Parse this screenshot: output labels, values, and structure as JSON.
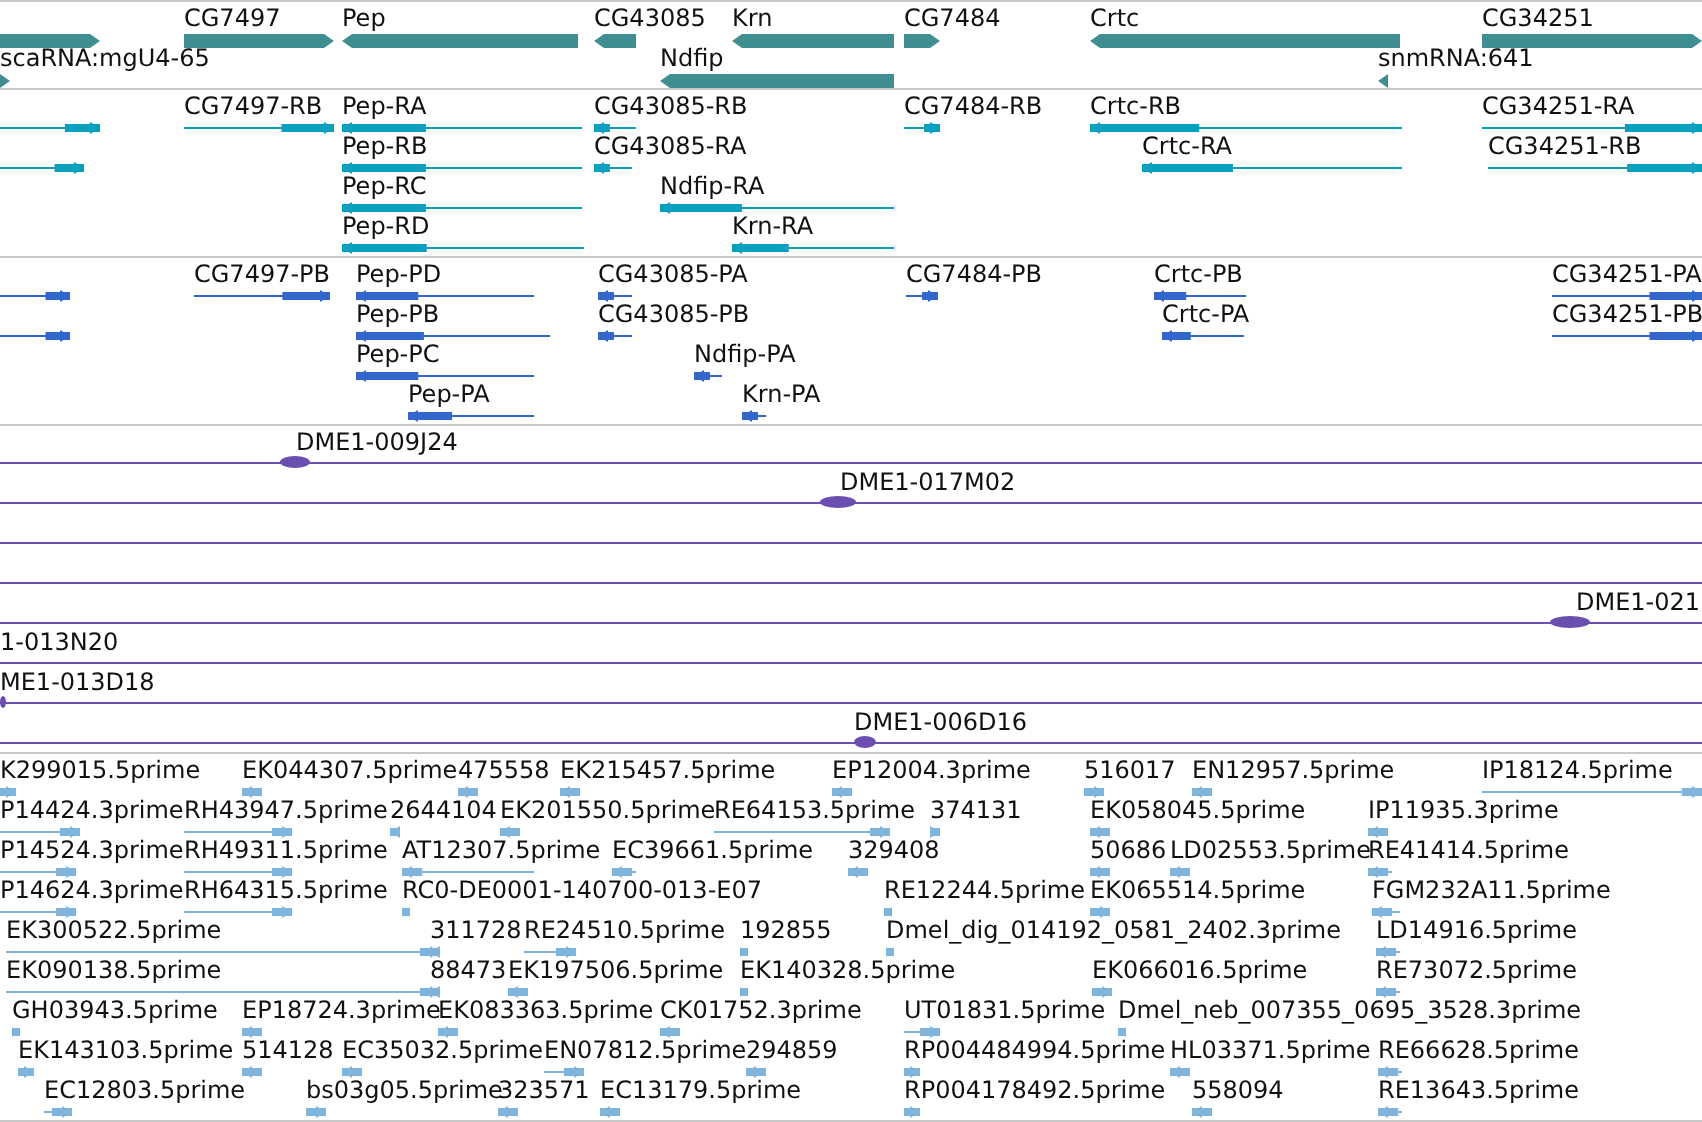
{
  "tracks": [
    {
      "kind": "gene",
      "color": "#3e8e92",
      "features": [
        {
          "label": "CG7497"
        },
        {
          "label": "Pep"
        },
        {
          "label": "CG43085"
        },
        {
          "label": "Krn"
        },
        {
          "label": "CG7484"
        },
        {
          "label": "Crtc"
        },
        {
          "label": "CG34251"
        },
        {
          "label": "scaRNA:mgU4-65"
        },
        {
          "label": "Ndfip"
        },
        {
          "label": "snmRNA:641"
        }
      ]
    },
    {
      "kind": "transcript",
      "color": "#09a0c0",
      "features": [
        {
          "label": "CG7497-RB"
        },
        {
          "label": "Pep-RA"
        },
        {
          "label": "CG43085-RB"
        },
        {
          "label": "CG7484-RB"
        },
        {
          "label": "Crtc-RB"
        },
        {
          "label": "CG34251-RA"
        },
        {
          "label": "Pep-RB"
        },
        {
          "label": "CG43085-RA"
        },
        {
          "label": "Crtc-RA"
        },
        {
          "label": "CG34251-RB"
        },
        {
          "label": "Pep-RC"
        },
        {
          "label": "Ndfip-RA"
        },
        {
          "label": "Pep-RD"
        },
        {
          "label": "Krn-RA"
        }
      ]
    },
    {
      "kind": "transcript",
      "color": "#3366cc",
      "features": [
        {
          "label": "CG7497-PB"
        },
        {
          "label": "Pep-PD"
        },
        {
          "label": "CG43085-PA"
        },
        {
          "label": "CG7484-PB"
        },
        {
          "label": "Crtc-PB"
        },
        {
          "label": "CG34251-PA"
        },
        {
          "label": "Pep-PB"
        },
        {
          "label": "CG43085-PB"
        },
        {
          "label": "Crtc-PA"
        },
        {
          "label": "CG34251-PB"
        },
        {
          "label": "Pep-PC"
        },
        {
          "label": "Ndfip-PA"
        },
        {
          "label": "Pep-PA"
        },
        {
          "label": "Krn-PA"
        }
      ]
    },
    {
      "kind": "clone",
      "color": "#6a4fb0",
      "features": [
        {
          "label": "DME1-009J24"
        },
        {
          "label": "DME1-017M02"
        },
        {
          "label": "DME1-021"
        },
        {
          "label": "1-013N20"
        },
        {
          "label": "ME1-013D18"
        },
        {
          "label": "DME1-006D16"
        }
      ]
    },
    {
      "kind": "est",
      "color": "#7fb5dc",
      "features": [
        {
          "label": "K299015.5prime"
        },
        {
          "label": "EK044307.5prime"
        },
        {
          "label": "475558"
        },
        {
          "label": "EK215457.5prime"
        },
        {
          "label": "EP12004.3prime"
        },
        {
          "label": "516017"
        },
        {
          "label": "EN12957.5prime"
        },
        {
          "label": "IP18124.5prime"
        },
        {
          "label": "P14424.3prime"
        },
        {
          "label": "RH43947.5prime"
        },
        {
          "label": "2644104"
        },
        {
          "label": "EK201550.5prime"
        },
        {
          "label": "RE64153.5prime"
        },
        {
          "label": "374131"
        },
        {
          "label": "EK058045.5prime"
        },
        {
          "label": "IP11935.3prime"
        },
        {
          "label": "P14524.3prime"
        },
        {
          "label": "RH49311.5prime"
        },
        {
          "label": "AT12307.5prime"
        },
        {
          "label": "EC39661.5prime"
        },
        {
          "label": "329408"
        },
        {
          "label": "50686"
        },
        {
          "label": "LD02553.5prime"
        },
        {
          "label": "RE41414.5prime"
        },
        {
          "label": "P14624.3prime"
        },
        {
          "label": "RH64315.5prime"
        },
        {
          "label": "RC0-DE0001-140700-013-E07"
        },
        {
          "label": "RE12244.5prime"
        },
        {
          "label": "EK065514.5prime"
        },
        {
          "label": "FGM232A11.5prime"
        },
        {
          "label": "EK300522.5prime"
        },
        {
          "label": "311728"
        },
        {
          "label": "RE24510.5prime"
        },
        {
          "label": "192855"
        },
        {
          "label": "Dmel_dig_014192_0581_2402.3prime"
        },
        {
          "label": "LD14916.5prime"
        },
        {
          "label": "EK090138.5prime"
        },
        {
          "label": "88473"
        },
        {
          "label": "EK197506.5prime"
        },
        {
          "label": "EK140328.5prime"
        },
        {
          "label": "EK066016.5prime"
        },
        {
          "label": "RE73072.5prime"
        },
        {
          "label": "GH03943.5prime"
        },
        {
          "label": "EP18724.3prime"
        },
        {
          "label": "EK083363.5prime"
        },
        {
          "label": "CK01752.3prime"
        },
        {
          "label": "UT01831.5prime"
        },
        {
          "label": "Dmel_neb_007355_0695_3528.3prime"
        },
        {
          "label": "EK143103.5prime"
        },
        {
          "label": "514128"
        },
        {
          "label": "EC35032.5prime"
        },
        {
          "label": "EN07812.5prime"
        },
        {
          "label": "294859"
        },
        {
          "label": "RP004484994.5prime"
        },
        {
          "label": "HL03371.5prime"
        },
        {
          "label": "RE66628.5prime"
        },
        {
          "label": "EC12803.5prime"
        },
        {
          "label": "bs03g05.5prime"
        },
        {
          "label": "323571"
        },
        {
          "label": "EC13179.5prime"
        },
        {
          "label": "RP004178492.5prime"
        },
        {
          "label": "558094"
        },
        {
          "label": "RE13643.5prime"
        }
      ]
    }
  ]
}
